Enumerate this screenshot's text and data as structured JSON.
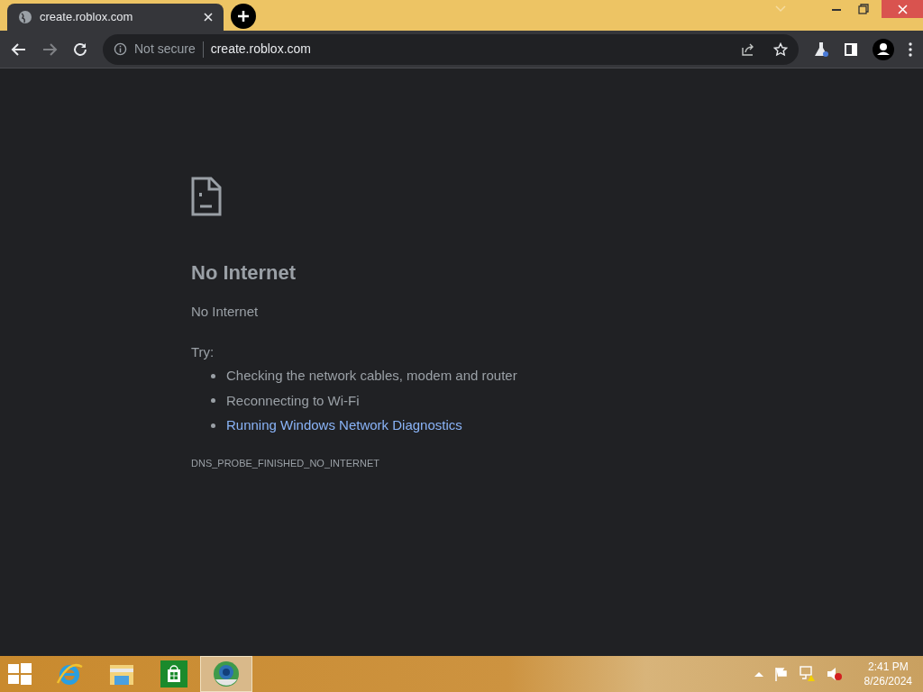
{
  "tab": {
    "title": "create.roblox.com",
    "selected": true
  },
  "address_bar": {
    "security": "Not secure",
    "url": "create.roblox.com"
  },
  "error": {
    "heading": "No Internet",
    "message": "No Internet",
    "try_label": "Try:",
    "suggestions": [
      {
        "kind": "text",
        "text": "Checking the network cables, modem and router"
      },
      {
        "kind": "text",
        "text": "Reconnecting to Wi-Fi"
      },
      {
        "kind": "link",
        "text": "Running Windows Network Diagnostics"
      }
    ],
    "code": "DNS_PROBE_FINISHED_NO_INTERNET"
  },
  "taskbar": {
    "apps": [
      {
        "kind": "ie",
        "selected": false
      },
      {
        "kind": "explorer",
        "selected": false
      },
      {
        "kind": "store",
        "selected": false
      },
      {
        "kind": "chrome",
        "selected": true
      }
    ],
    "time": "2:41 PM",
    "date": "8/26/2024"
  }
}
